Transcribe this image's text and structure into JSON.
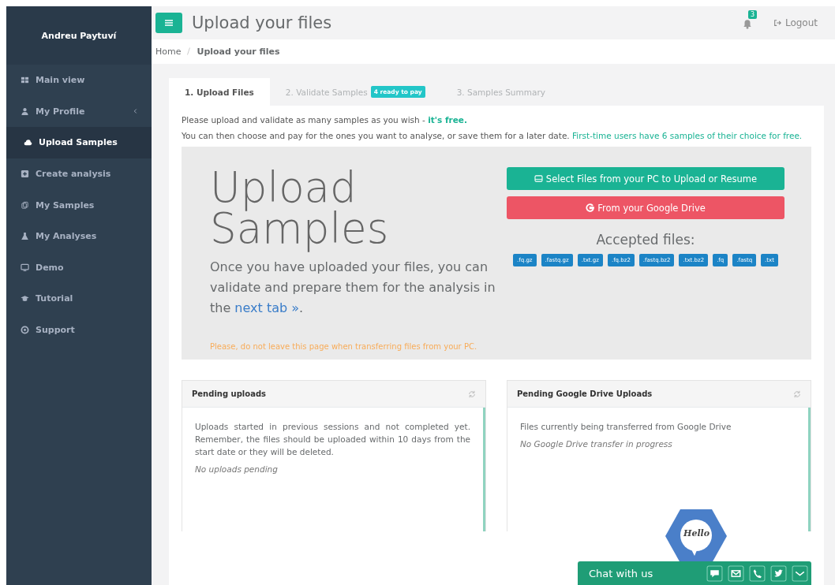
{
  "sidebar": {
    "user": "Andreu Paytuví",
    "items": [
      {
        "label": "Main view",
        "selected": false,
        "caret": false
      },
      {
        "label": "My Profile",
        "selected": false,
        "caret": true
      },
      {
        "label": "Upload Samples",
        "selected": true,
        "caret": false
      },
      {
        "label": "Create analysis",
        "selected": false,
        "caret": false
      },
      {
        "label": "My Samples",
        "selected": false,
        "caret": false
      },
      {
        "label": "My Analyses",
        "selected": false,
        "caret": false
      },
      {
        "label": "Demo",
        "selected": false,
        "caret": false
      },
      {
        "label": "Tutorial",
        "selected": false,
        "caret": false
      },
      {
        "label": "Support",
        "selected": false,
        "caret": false
      }
    ]
  },
  "header": {
    "title": "Upload your files",
    "notifications": "3",
    "logout": "Logout"
  },
  "breadcrumb": [
    "Home",
    "Upload your files"
  ],
  "tabs": [
    {
      "label": "1. Upload Files",
      "selected": true
    },
    {
      "label": "2. Validate Samples",
      "selected": false,
      "badge": "4 ready to pay"
    },
    {
      "label": "3. Samples Summary",
      "selected": false
    }
  ],
  "intro": [
    {
      "text": "Please upload and validate as many samples as you wish - **it's free.**"
    },
    {
      "text": "You can then choose and pay for the ones you want to analyse, or save them for a later date.",
      "highlight": "First-time users have 6 samples of their choice for free."
    }
  ],
  "upload": {
    "heading_1": "Upload",
    "heading_2": "Samples",
    "description": "Once you have uploaded your files, you can validate and prepare them for the analysis in the",
    "link": "next tab »",
    "after_link": ".",
    "warning": "Please, do not leave this page when transferring files from your PC.",
    "pc_button": "Select Files from your PC to Upload or Resume",
    "drive_button": "From your Google Drive",
    "accepted_title": "Accepted files:",
    "extensions": [
      ".fq.gz",
      ".fastq.gz",
      ".txt.gz",
      ".fq.bz2",
      ".fastq.bz2",
      ".txt.bz2",
      ".fq",
      ".fastq",
      ".txt"
    ]
  },
  "panels": [
    {
      "title": "Pending uploads",
      "description": "Uploads started in previous sessions and not completed yet. Remember, the files should be uploaded within 10 days from the start date or they will be deleted.",
      "status": "No uploads pending"
    },
    {
      "title": "Pending Google Drive Uploads",
      "description": "Files currently being transferred from Google Drive",
      "status": "No Google Drive transfer in progress"
    }
  ],
  "chat": {
    "badge": "Hello",
    "label": "Chat with us"
  }
}
